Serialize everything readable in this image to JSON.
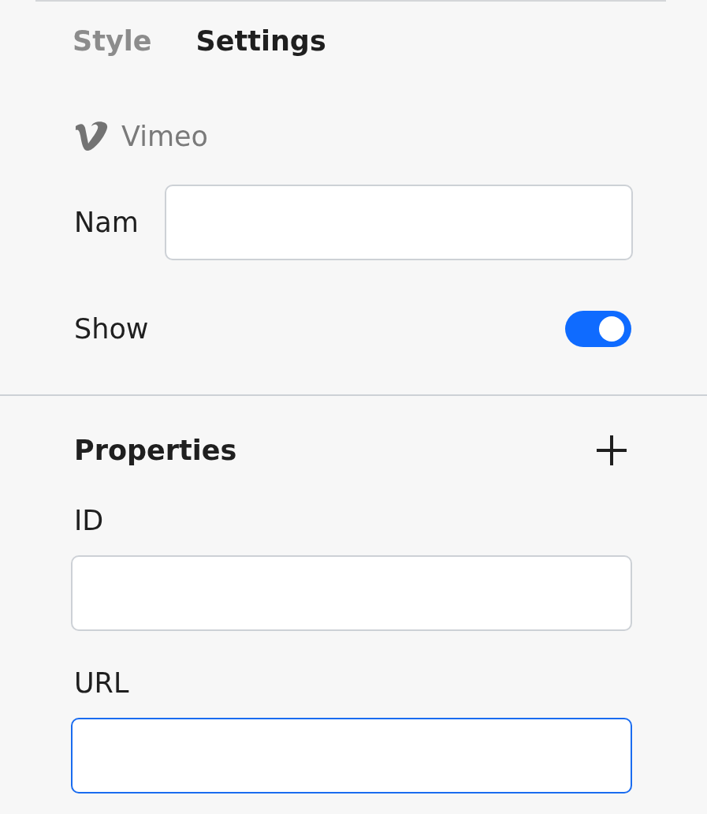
{
  "tabs": [
    {
      "label": "Style",
      "selected": false
    },
    {
      "label": "Settings",
      "selected": true
    }
  ],
  "component": {
    "name": "Vimeo"
  },
  "name_field": {
    "label": "Nam",
    "focused": false
  },
  "show": {
    "label": "Show",
    "on": true
  },
  "properties": {
    "title": "Properties",
    "fields": [
      {
        "label": "ID",
        "focused": false
      },
      {
        "label": "URL",
        "focused": true
      }
    ]
  }
}
